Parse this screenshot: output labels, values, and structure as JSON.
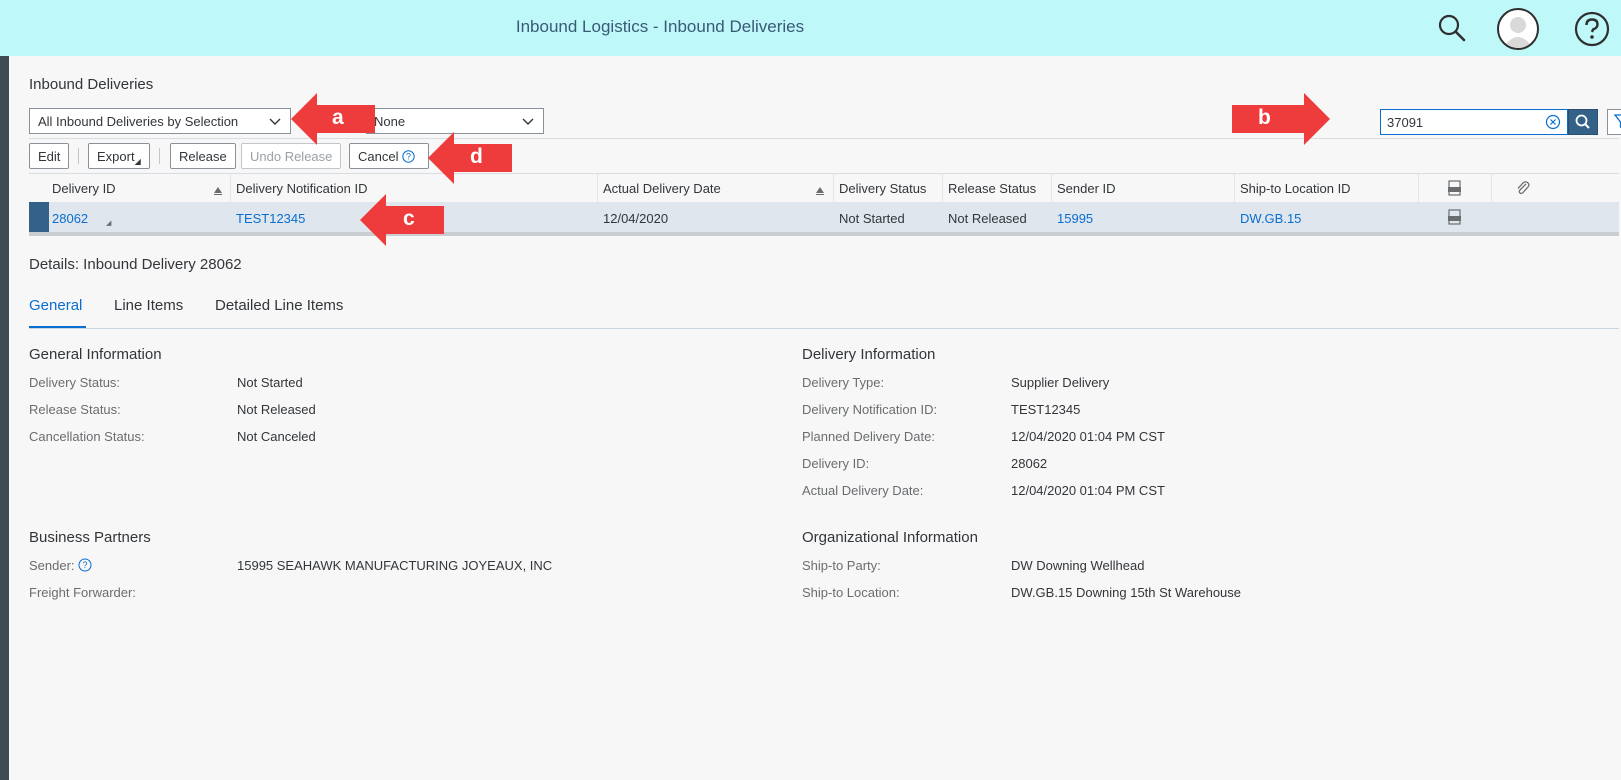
{
  "shell": {
    "title": "Inbound Logistics - Inbound Deliveries"
  },
  "page": {
    "title": "Inbound Deliveries",
    "variant_select": "All Inbound Deliveries by Selection",
    "second_select": "None",
    "search_value": "37091"
  },
  "toolbar": {
    "edit": "Edit",
    "export": "Export",
    "release": "Release",
    "undo_release": "Undo Release",
    "cancel": "Cancel"
  },
  "table": {
    "columns": [
      "Delivery ID",
      "Delivery Notification ID",
      "Actual Delivery Date",
      "Delivery Status",
      "Release Status",
      "Sender ID",
      "Ship-to Location ID"
    ],
    "rows": [
      {
        "delivery_id": "28062",
        "notification_id": "TEST12345",
        "actual_date": "12/04/2020",
        "delivery_status": "Not Started",
        "release_status": "Not Released",
        "sender_id": "15995",
        "ship_to": "DW.GB.15"
      }
    ]
  },
  "details": {
    "title": "Details: Inbound Delivery 28062",
    "tabs": [
      "General",
      "Line Items",
      "Detailed Line Items"
    ],
    "general_info": {
      "heading": "General Information",
      "fields": [
        {
          "label": "Delivery Status:",
          "value": "Not Started"
        },
        {
          "label": "Release Status:",
          "value": "Not Released"
        },
        {
          "label": "Cancellation Status:",
          "value": "Not Canceled"
        }
      ]
    },
    "delivery_info": {
      "heading": "Delivery Information",
      "fields": [
        {
          "label": "Delivery Type:",
          "value": "Supplier Delivery"
        },
        {
          "label": "Delivery Notification ID:",
          "value": "TEST12345"
        },
        {
          "label": "Planned Delivery Date:",
          "value": "12/04/2020 01:04 PM CST"
        },
        {
          "label": "Delivery ID:",
          "value": "28062"
        },
        {
          "label": "Actual Delivery Date:",
          "value": "12/04/2020 01:04 PM CST"
        }
      ]
    },
    "business_partners": {
      "heading": "Business Partners",
      "sender_label": "Sender:",
      "sender_value": "15995 SEAHAWK MANUFACTURING JOYEAUX, INC",
      "freight_label": "Freight Forwarder:"
    },
    "org_info": {
      "heading": "Organizational Information",
      "fields": [
        {
          "label": "Ship-to Party:",
          "value": "DW Downing Wellhead"
        },
        {
          "label": "Ship-to Location:",
          "value": "DW.GB.15 Downing 15th St Warehouse"
        }
      ]
    }
  },
  "annotations": {
    "a": "a",
    "b": "b",
    "c": "c",
    "d": "d"
  },
  "colors": {
    "shell_bg": "#bff8f8",
    "link": "#0a6ed1",
    "arrow": "#ee3b3b",
    "selected_row": "#dfe6ee"
  },
  "icons": [
    "search-icon",
    "user-avatar-icon",
    "help-icon",
    "clear-icon",
    "filter-icon",
    "sort-icon",
    "pdf-icon",
    "attachment-icon",
    "chevron-down-icon"
  ]
}
